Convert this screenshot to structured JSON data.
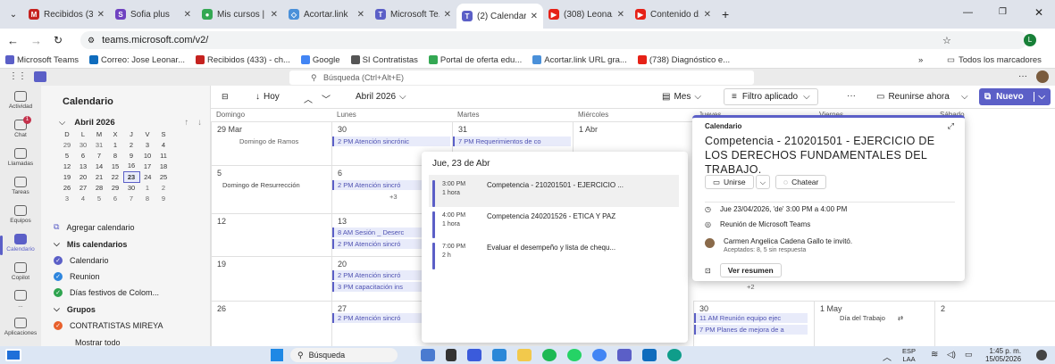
{
  "browser": {
    "tabs": [
      {
        "title": "Recibidos (3...",
        "fav": "M",
        "color": "#c5221f"
      },
      {
        "title": "Sofia plus",
        "fav": "S",
        "color": "#6f42c1"
      },
      {
        "title": "Mis cursos |",
        "fav": "●",
        "color": "#34a853"
      },
      {
        "title": "Acortar.link",
        "fav": "◇",
        "color": "#4a90d9"
      },
      {
        "title": "Microsoft Te...",
        "fav": "T",
        "color": "#5b5fc7"
      },
      {
        "title": "(2) Calendar",
        "fav": "T",
        "color": "#5b5fc7",
        "active": true
      },
      {
        "title": "(308) Leona...",
        "fav": "▶",
        "color": "#e62117"
      },
      {
        "title": "Contenido d...",
        "fav": "▶",
        "color": "#e62117"
      }
    ],
    "url": "teams.microsoft.com/v2/",
    "bookmarks": [
      "Microsoft Teams",
      "Correo: Jose Leonar...",
      "Recibidos (433) - ch...",
      "Google",
      "SI Contratistas",
      "Portal de oferta edu...",
      "Acortar.link URL gra...",
      "(738) Diagnóstico e..."
    ],
    "bookmarks_all": "Todos los marcadores",
    "more": "»"
  },
  "teams": {
    "search_placeholder": "Búsqueda (Ctrl+Alt+E)",
    "rail": [
      {
        "label": "Actividad",
        "icon": "bell-icon"
      },
      {
        "label": "Chat",
        "icon": "chat-icon"
      },
      {
        "label": "Llamadas",
        "icon": "phone-icon"
      },
      {
        "label": "Tareas",
        "icon": "tasks-icon"
      },
      {
        "label": "Equipos",
        "icon": "teams-icon"
      },
      {
        "label": "Calendario",
        "icon": "calendar-icon",
        "selected": true
      },
      {
        "label": "Copilot",
        "icon": "copilot-icon"
      },
      {
        "label": "...",
        "icon": "more-icon"
      },
      {
        "label": "Aplicaciones",
        "icon": "apps-icon"
      }
    ],
    "chat_badge": "1"
  },
  "left": {
    "title": "Calendario",
    "month": "Abril 2026",
    "weekdays": [
      "D",
      "L",
      "M",
      "X",
      "J",
      "V",
      "S"
    ],
    "weeks": [
      [
        "29",
        "30",
        "31",
        "1",
        "2",
        "3",
        "4"
      ],
      [
        "5",
        "6",
        "7",
        "8",
        "9",
        "10",
        "11"
      ],
      [
        "12",
        "13",
        "14",
        "15",
        "16",
        "17",
        "18"
      ],
      [
        "19",
        "20",
        "21",
        "22",
        "23",
        "24",
        "25"
      ],
      [
        "26",
        "27",
        "28",
        "29",
        "30",
        "1",
        "2"
      ],
      [
        "3",
        "4",
        "5",
        "6",
        "7",
        "8",
        "9"
      ]
    ],
    "add_calendar": "Agregar calendario",
    "my_calendars": "Mis calendarios",
    "calendars": [
      {
        "name": "Calendario",
        "color": "#5b5fc7"
      },
      {
        "name": "Reunion",
        "color": "#2e86de"
      },
      {
        "name": "Días festivos de Colom...",
        "color": "#2ea44f"
      }
    ],
    "groups": "Grupos",
    "group_items": [
      {
        "name": "CONTRATISTAS MIREYA",
        "color": "#e8602c"
      }
    ],
    "show_all": "Mostrar todo"
  },
  "toolbar": {
    "today": "Hoy",
    "month_label": "Abril 2026",
    "view": "Mes",
    "filter": "Filtro aplicado",
    "more": "···",
    "meet_now": "Reunirse ahora",
    "new": "Nuevo"
  },
  "grid": {
    "headers": [
      "Domingo",
      "Lunes",
      "Martes",
      "Miércoles",
      "Jueves",
      "Viernes",
      "Sábado"
    ],
    "r1": {
      "d0": "29 Mar",
      "d1": "30",
      "d2": "31",
      "d3": "1 Abr",
      "e0": "Domingo de Ramos",
      "e1": "2 PM Atención sincrónic",
      "e2": "7 PM Requerimientos de co"
    },
    "r2": {
      "d0": "5",
      "d1": "6",
      "e0": "Domingo de Resurrección",
      "e1": "2 PM Atención sincró",
      "more1": "+3"
    },
    "r3": {
      "d0": "12",
      "d1": "13",
      "e1a": "8 AM Sesión _ Deserc",
      "e1b": "2 PM Atención sincró"
    },
    "r4": {
      "d0": "19",
      "d1": "20",
      "e1a": "2 PM Atención sincró",
      "e1b": "3 PM capacitación ins",
      "more4": "+2"
    },
    "r5": {
      "d0": "26",
      "d1": "27",
      "d4": "30",
      "d5": "1 May",
      "d6": "2",
      "e1": "2 PM Atención sincró",
      "e4a": "11 AM Reunión equipo ejec",
      "e4b": "7 PM Planes de mejora de a",
      "e5": "Día del Trabajo"
    }
  },
  "daypop": {
    "title": "Jue, 23 de Abr",
    "events": [
      {
        "time": "3:00 PM",
        "dur": "1 hora",
        "title": "Competencia - 210201501 - EJERCICIO ..."
      },
      {
        "time": "4:00 PM",
        "dur": "1 hora",
        "title": "Competencia 240201526 - ETICA Y PAZ"
      },
      {
        "time": "7:00 PM",
        "dur": "2 h",
        "title": "Evaluar el desempeño y lista de chequ..."
      }
    ]
  },
  "evpop": {
    "calendar": "Calendario",
    "title": "Competencia - 210201501 - EJERCICIO DE LOS DERECHOS FUNDAMENTALES DEL TRABAJO.",
    "join": "Unirse",
    "chat": "Chatear",
    "when": "Jue 23/04/2026, 'de' 3:00 PM a 4:00 PM",
    "where": "Reunión de Microsoft Teams",
    "organizer": "Carmen Angelica Cadena Gallo te invitó.",
    "responses": "Aceptados: 8, 5 sin respuesta",
    "summary": "Ver resumen"
  },
  "taskbar": {
    "search": "Búsqueda",
    "lang": "ESP",
    "lang2": "LAA",
    "time": "1:45 p. m.",
    "date": "15/05/2026"
  }
}
